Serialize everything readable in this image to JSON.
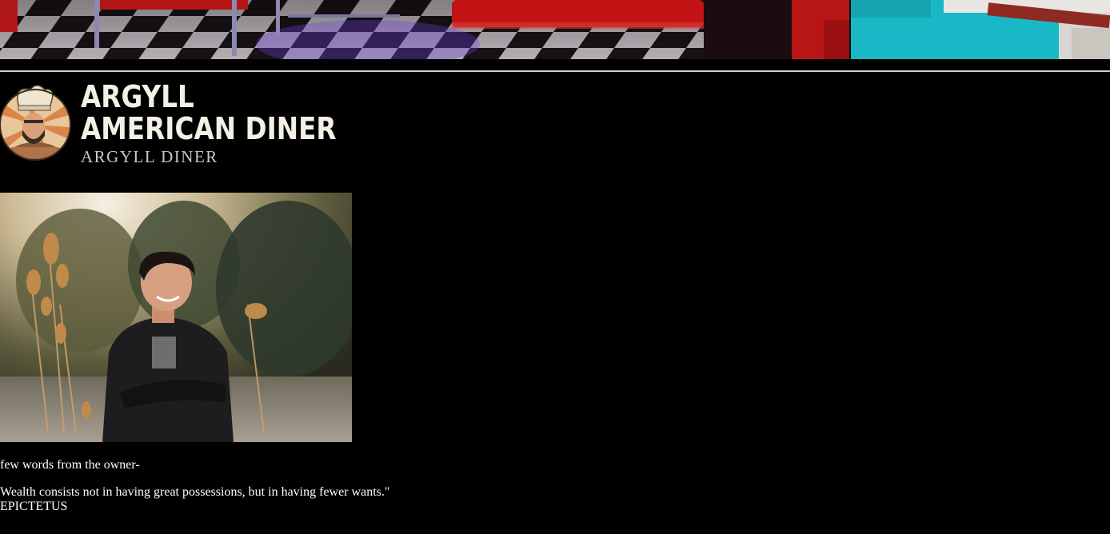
{
  "banner": {
    "alt": "Diner interior banner"
  },
  "logo": {
    "line1": "ARGYLL",
    "line2": "AMERICAN DINER",
    "subtitle": "ARGYLL DINER",
    "badge_icon": "chef-mascot-icon"
  },
  "owner_section": {
    "photo_alt": "Owner portrait",
    "heading": "few words from the owner-",
    "quote": "Wealth consists not in having great possessions, but in having fewer wants.\"",
    "author": "EPICTETUS"
  },
  "colors": {
    "background": "#000000",
    "text": "#ffffff",
    "logo_text": "#f4f0e6",
    "subtitle": "#c8c8c8"
  }
}
